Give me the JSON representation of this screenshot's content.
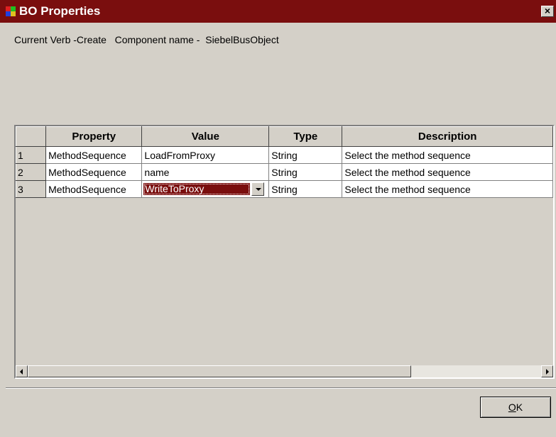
{
  "window": {
    "title": "BO Properties",
    "close_glyph": "×",
    "icon": "app-icon",
    "title_bar_color": "#7a0e0e"
  },
  "info": {
    "text": "Current Verb -Create   Component name -  SiebelBusObject"
  },
  "grid": {
    "columns": [
      "",
      "Property",
      "Value",
      "Type",
      "Description"
    ],
    "rows": [
      {
        "num": "1",
        "property": "MethodSequence",
        "value": "LoadFromProxy",
        "type": "String",
        "description": "Select the method sequence"
      },
      {
        "num": "2",
        "property": "MethodSequence",
        "value": "name",
        "type": "String",
        "description": "Select the method sequence"
      },
      {
        "num": "3",
        "property": "MethodSequence",
        "value": "WriteToProxy",
        "type": "String",
        "description": "Select the method sequence"
      }
    ],
    "editing_row": 3,
    "selection_color": "#7a0e0e"
  },
  "buttons": {
    "ok_mnemonic": "O",
    "ok_rest": "K"
  }
}
